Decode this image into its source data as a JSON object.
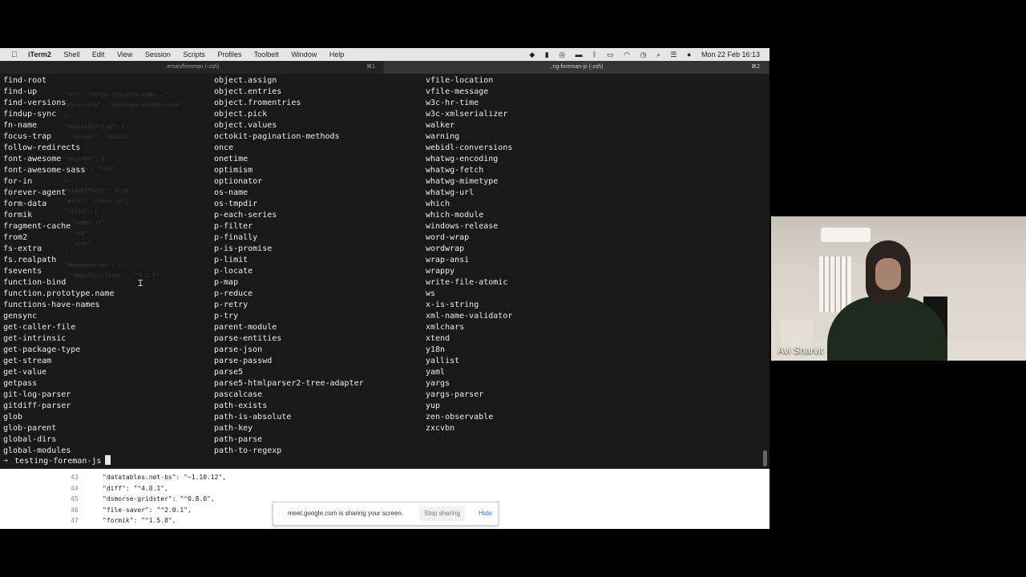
{
  "menubar": {
    "apple": "",
    "app": "iTerm2",
    "items": [
      "Shell",
      "Edit",
      "View",
      "Session",
      "Scripts",
      "Profiles",
      "Toolbelt",
      "Window",
      "Help"
    ],
    "clock": "Mon 22 Feb  16:13"
  },
  "tabs": [
    {
      "title": "..eman/foreman (-zsh)",
      "shortcut": "⌘1"
    },
    {
      "title": "..ng-foreman-js (-zsh)",
      "shortcut": "⌘2"
    }
  ],
  "terminal": {
    "column1": [
      "find-root",
      "find-up",
      "find-versions",
      "findup-sync",
      "fn-name",
      "focus-trap",
      "follow-redirects",
      "font-awesome",
      "font-awesome-sass",
      "for-in",
      "forever-agent",
      "form-data",
      "formik",
      "fragment-cache",
      "from2",
      "fs-extra",
      "fs.realpath",
      "fsevents",
      "function-bind",
      "function.prototype.name",
      "functions-have-names",
      "gensync",
      "get-caller-file",
      "get-intrinsic",
      "get-package-type",
      "get-stream",
      "get-value",
      "getpass",
      "git-log-parser",
      "gitdiff-parser",
      "glob",
      "glob-parent",
      "global-dirs",
      "global-modules"
    ],
    "column2": [
      "object.assign",
      "object.entries",
      "object.fromentries",
      "object.pick",
      "object.values",
      "octokit-pagination-methods",
      "once",
      "onetime",
      "optimism",
      "optionator",
      "os-name",
      "os-tmpdir",
      "p-each-series",
      "p-filter",
      "p-finally",
      "p-is-promise",
      "p-limit",
      "p-locate",
      "p-map",
      "p-reduce",
      "p-retry",
      "p-try",
      "parent-module",
      "parse-entities",
      "parse-json",
      "parse-passwd",
      "parse5",
      "parse5-htmlparser2-tree-adapter",
      "pascalcase",
      "path-exists",
      "path-is-absolute",
      "path-key",
      "path-parse",
      "path-to-regexp"
    ],
    "column3": [
      "vfile-location",
      "vfile-message",
      "w3c-hr-time",
      "w3c-xmlserializer",
      "walker",
      "warning",
      "webidl-conversions",
      "whatwg-encoding",
      "whatwg-fetch",
      "whatwg-mimetype",
      "whatwg-url",
      "which",
      "which-module",
      "windows-release",
      "word-wrap",
      "wordwrap",
      "wrap-ansi",
      "wrappy",
      "write-file-atomic",
      "ws",
      "x-is-string",
      "xml-name-validator",
      "xmlchars",
      "xtend",
      "y18n",
      "yallist",
      "yaml",
      "yargs",
      "yargs-parser",
      "yup",
      "zen-observable",
      "zxcvbn"
    ],
    "prompt_arrow": "➜",
    "prompt_dir": "testing-foreman-js"
  },
  "code_behind": [
    {
      "line": "43",
      "text": "\"datatables.net-bs\": \"~1.10.12\","
    },
    {
      "line": "44",
      "text": "\"diff\": \"^4.0.1\","
    },
    {
      "line": "45",
      "text": "\"dsmorse-gridster\": \"^0.8.0\","
    },
    {
      "line": "46",
      "text": "\"file-saver\": \"^2.0.1\","
    },
    {
      "line": "47",
      "text": "\"formik\": \"^1.5.8\","
    }
  ],
  "share_banner": {
    "message": "meet.google.com is sharing your screen.",
    "stop_label": "Stop sharing",
    "hide_label": "Hide"
  },
  "participant": {
    "name": "Avi Sharvit"
  }
}
